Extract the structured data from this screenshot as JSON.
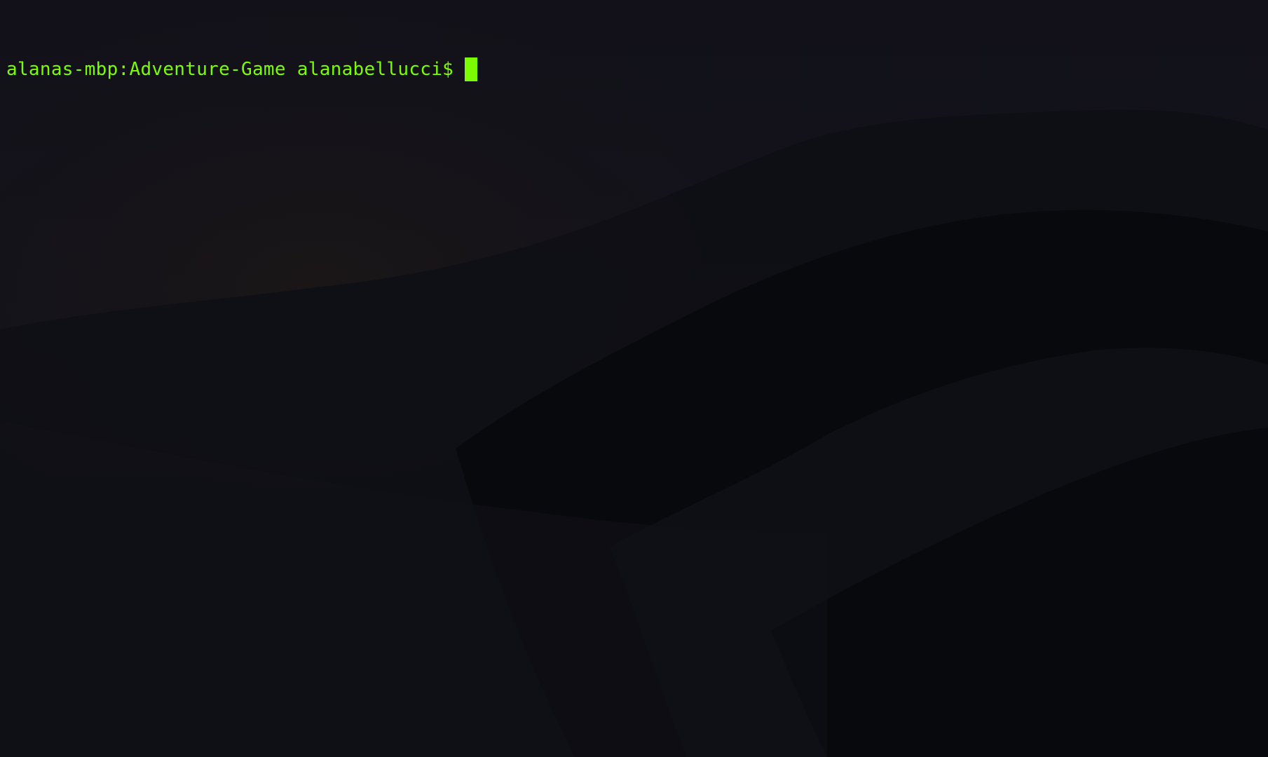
{
  "terminal": {
    "prompt": "alanas-mbp:Adventure-Game alanabellucci$",
    "cursor_color": "#7CFC00",
    "text_color": "#7CFC00",
    "background_color": "#0d0d14"
  },
  "wallpaper": {
    "icon": "mountain-landscape-wallpaper"
  }
}
